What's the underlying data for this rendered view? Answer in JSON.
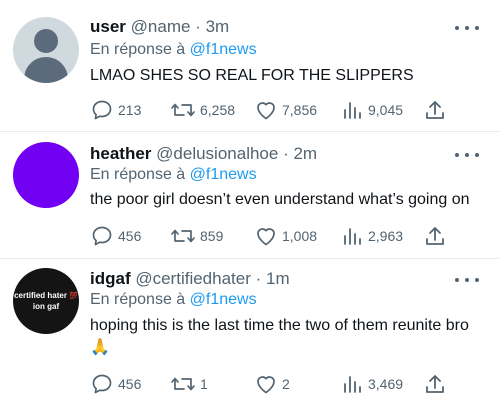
{
  "tweets": [
    {
      "username": "user",
      "handle": "@name",
      "time": "3m",
      "reply_prefix": "En réponse à",
      "reply_to": "@f1news",
      "text": "LMAO SHES SO REAL FOR THE SLIPPERS",
      "avatar_icon": "default-profile-icon",
      "replies": "213",
      "retweets": "6,258",
      "likes": "7,856",
      "views": "9,045"
    },
    {
      "username": "heather",
      "handle": "@delusionalhoe",
      "time": "2m",
      "reply_prefix": "En réponse à",
      "reply_to": "@f1news",
      "text": "the poor girl doesn’t even understand what’s going on",
      "avatar_color": "#7200f2",
      "replies": "456",
      "retweets": "859",
      "likes": "1,008",
      "views": "2,963"
    },
    {
      "username": "idgaf",
      "handle": "@certifiedhater",
      "time": "1m",
      "reply_prefix": "En réponse à",
      "reply_to": "@f1news",
      "text": "hoping this is the last time the two of them reunite bro",
      "emoji": "🙏",
      "avatar_text_line1": "certified hater",
      "avatar_text_emoji": "💯",
      "avatar_text_line2": "ion gaf",
      "replies": "456",
      "retweets": "1",
      "likes": "2",
      "views": "3,469"
    }
  ],
  "separator": " · ",
  "colors": {
    "accent": "#1d9bf0",
    "muted": "#536471",
    "text": "#0f1419"
  }
}
